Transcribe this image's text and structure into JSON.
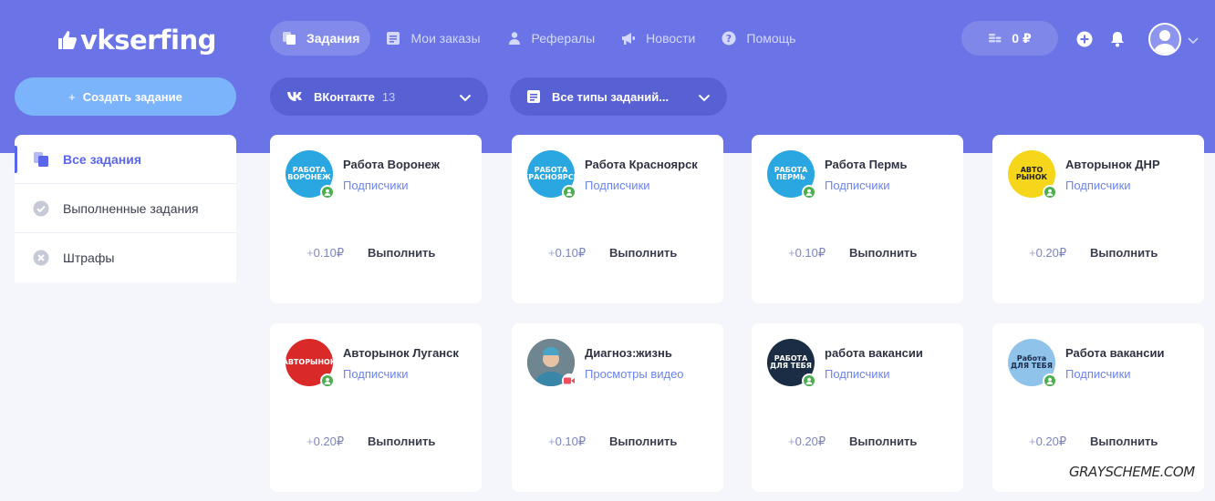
{
  "brand": {
    "logo_text": "vkserfing"
  },
  "nav": {
    "items": [
      {
        "label": "Задания",
        "icon": "copy-icon",
        "active": true
      },
      {
        "label": "Мои заказы",
        "icon": "document-icon",
        "active": false
      },
      {
        "label": "Рефералы",
        "icon": "person-icon",
        "active": false
      },
      {
        "label": "Новости",
        "icon": "megaphone-icon",
        "active": false
      },
      {
        "label": "Помощь",
        "icon": "question-icon",
        "active": false
      }
    ]
  },
  "header": {
    "balance": "0 ₽",
    "balance_icon": "coins-icon",
    "add_icon": "plus-circle-icon",
    "bell_icon": "bell-icon",
    "avatar_icon": "user-avatar-icon"
  },
  "actions": {
    "create_task_label": "Создать задание",
    "create_task_icon": "+"
  },
  "filters": {
    "network": {
      "label": "ВКонтакте",
      "count": "13",
      "icon": "vk-icon"
    },
    "task_type": {
      "label": "Все типы заданий...",
      "icon": "document-icon"
    }
  },
  "sidebar": {
    "items": [
      {
        "label": "Все задания",
        "icon": "copy-icon",
        "active": true
      },
      {
        "label": "Выполненные задания",
        "icon": "check-circle-icon",
        "active": false
      },
      {
        "label": "Штрафы",
        "icon": "x-circle-icon",
        "active": false
      }
    ]
  },
  "tasks": [
    {
      "title": "Работа Воронеж",
      "type": "Подписчики",
      "reward": "0.10₽",
      "action": "Выполнить",
      "avatar_text": "РАБОТА ВОРОНЕЖ",
      "avatar_color": "#2aa7e0",
      "badge": "subscribe"
    },
    {
      "title": "Работа Красноярск",
      "type": "Подписчики",
      "reward": "0.10₽",
      "action": "Выполнить",
      "avatar_text": "РАБОТА КРАСНОЯРСК",
      "avatar_color": "#2aa7e0",
      "badge": "subscribe"
    },
    {
      "title": "Работа Пермь",
      "type": "Подписчики",
      "reward": "0.10₽",
      "action": "Выполнить",
      "avatar_text": "РАБОТА ПЕРМЬ",
      "avatar_color": "#2aa7e0",
      "badge": "subscribe"
    },
    {
      "title": "Авторынок ДНР",
      "type": "Подписчики",
      "reward": "0.20₽",
      "action": "Выполнить",
      "avatar_text": "АВТО РЫНОК",
      "avatar_color": "#f6d61a",
      "badge": "subscribe"
    },
    {
      "title": "Авторынок Луганск",
      "type": "Подписчики",
      "reward": "0.20₽",
      "action": "Выполнить",
      "avatar_text": "АВТОРЫНОК",
      "avatar_color": "#d92929",
      "badge": "subscribe"
    },
    {
      "title": "Диагноз:жизнь",
      "type": "Просмотры видео",
      "reward": "0.10₽",
      "action": "Выполнить",
      "avatar_text": "",
      "avatar_color": "#4b5a62",
      "badge": "video"
    },
    {
      "title": "работа вакансии",
      "type": "Подписчики",
      "reward": "0.20₽",
      "action": "Выполнить",
      "avatar_text": "РАБОТА ДЛЯ ТЕБЯ",
      "avatar_color": "#1b2d44",
      "badge": "subscribe"
    },
    {
      "title": "Работа вакансии",
      "type": "Подписчики",
      "reward": "0.20₽",
      "action": "Выполнить",
      "avatar_text": "Работа ДЛЯ ТЕБЯ",
      "avatar_color": "#8fc3ea",
      "badge": "subscribe"
    }
  ],
  "watermark": "GRAYSCHEME.COM",
  "colors": {
    "header_bg": "#6a74e6",
    "accent": "#5b67ea",
    "create_button": "#7cb4fc",
    "link": "#6c84ee"
  }
}
